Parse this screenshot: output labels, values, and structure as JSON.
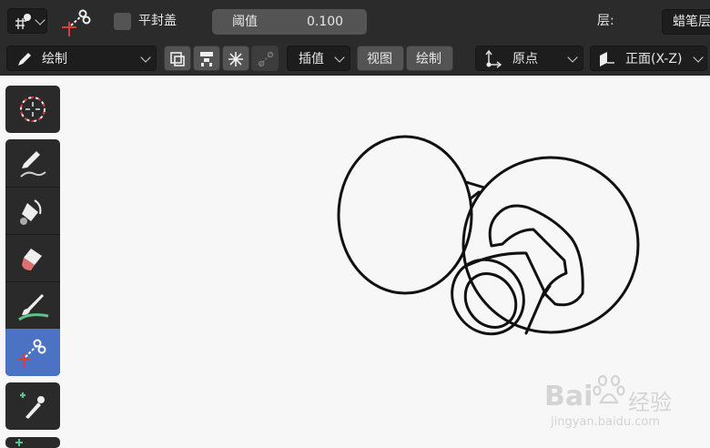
{
  "header": {
    "mode_icon": "grease-pencil-mode-icon",
    "tool_icon": "cutter-icon",
    "flat_caps_label": "平封盖",
    "threshold_label": "阈值",
    "threshold_value": "0.100",
    "layer_label": "层:",
    "layer_value": "蜡笔层"
  },
  "toolbar2": {
    "mode_select": "绘制",
    "mode_icon": "pencil-icon",
    "toggle_icons": [
      "copy-icon",
      "layers-icon",
      "snowflake-icon",
      "link-icon"
    ],
    "interp_select": "插值",
    "view_button": "视图",
    "draw_button": "绘制",
    "origin_icon": "origin-axes-icon",
    "origin_select": "原点",
    "front_icon": "front-plane-icon",
    "front_select": "正面(X-Z)"
  },
  "left_tools": [
    {
      "name": "cursor-tool",
      "icon": "cursor-icon",
      "active": false
    },
    {
      "name": "draw-tool",
      "icon": "pencil-stroke-icon",
      "active": false
    },
    {
      "name": "fill-tool",
      "icon": "paint-bucket-icon",
      "active": false
    },
    {
      "name": "erase-tool",
      "icon": "eraser-icon",
      "active": false
    },
    {
      "name": "tint-tool",
      "icon": "brush-icon",
      "active": false
    },
    {
      "name": "cutter-tool",
      "icon": "cutter-icon",
      "active": true
    },
    {
      "name": "eyedropper-tool",
      "icon": "eyedropper-icon",
      "active": false
    }
  ],
  "watermark": {
    "brand_left": "Bai",
    "brand_right": "经验",
    "url": "jingyan.baidu.com"
  },
  "colors": {
    "active_tool": "#4b72c3",
    "bar_bg": "#2b2b2b",
    "canvas_bg": "#f7f7f7"
  }
}
